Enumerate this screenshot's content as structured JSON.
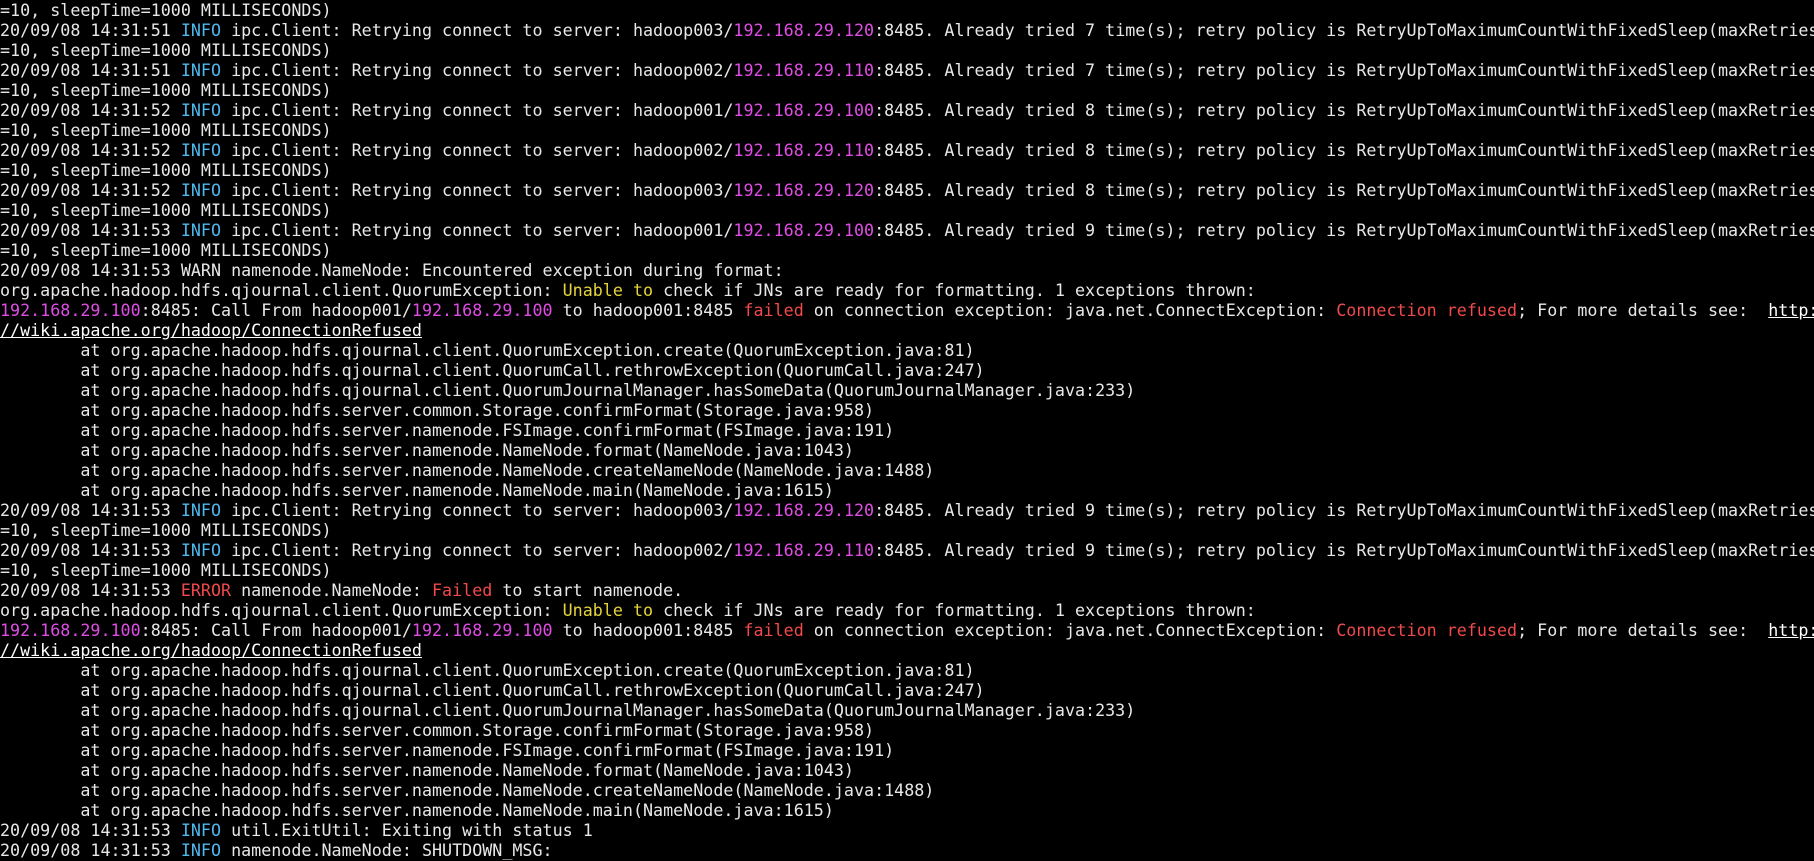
{
  "colors": {
    "background": "#000000",
    "text": "#e8e8e8",
    "info": "#4fb8ec",
    "ip": "#e04ce6",
    "error": "#f04a4a",
    "warning_phrase": "#e6d43a",
    "link": "#ffffff"
  },
  "terminal": {
    "lines": [
      [
        {
          "t": "=10, sleepTime=1000 MILLISECONDS)",
          "s": "plain"
        }
      ],
      [
        {
          "t": "20/09/08 14:31:51 ",
          "s": "plain"
        },
        {
          "t": "INFO",
          "s": "info"
        },
        {
          "t": " ipc.Client: Retrying connect to server: hadoop003/",
          "s": "plain"
        },
        {
          "t": "192.168.29.120",
          "s": "ip"
        },
        {
          "t": ":8485. Already tried 7 time(s); retry policy is RetryUpToMaximumCountWithFixedSleep(maxRetries",
          "s": "plain"
        }
      ],
      [
        {
          "t": "=10, sleepTime=1000 MILLISECONDS)",
          "s": "plain"
        }
      ],
      [
        {
          "t": "20/09/08 14:31:51 ",
          "s": "plain"
        },
        {
          "t": "INFO",
          "s": "info"
        },
        {
          "t": " ipc.Client: Retrying connect to server: hadoop002/",
          "s": "plain"
        },
        {
          "t": "192.168.29.110",
          "s": "ip"
        },
        {
          "t": ":8485. Already tried 7 time(s); retry policy is RetryUpToMaximumCountWithFixedSleep(maxRetries",
          "s": "plain"
        }
      ],
      [
        {
          "t": "=10, sleepTime=1000 MILLISECONDS)",
          "s": "plain"
        }
      ],
      [
        {
          "t": "20/09/08 14:31:52 ",
          "s": "plain"
        },
        {
          "t": "INFO",
          "s": "info"
        },
        {
          "t": " ipc.Client: Retrying connect to server: hadoop001/",
          "s": "plain"
        },
        {
          "t": "192.168.29.100",
          "s": "ip"
        },
        {
          "t": ":8485. Already tried 8 time(s); retry policy is RetryUpToMaximumCountWithFixedSleep(maxRetries",
          "s": "plain"
        }
      ],
      [
        {
          "t": "=10, sleepTime=1000 MILLISECONDS)",
          "s": "plain"
        }
      ],
      [
        {
          "t": "20/09/08 14:31:52 ",
          "s": "plain"
        },
        {
          "t": "INFO",
          "s": "info"
        },
        {
          "t": " ipc.Client: Retrying connect to server: hadoop002/",
          "s": "plain"
        },
        {
          "t": "192.168.29.110",
          "s": "ip"
        },
        {
          "t": ":8485. Already tried 8 time(s); retry policy is RetryUpToMaximumCountWithFixedSleep(maxRetries",
          "s": "plain"
        }
      ],
      [
        {
          "t": "=10, sleepTime=1000 MILLISECONDS)",
          "s": "plain"
        }
      ],
      [
        {
          "t": "20/09/08 14:31:52 ",
          "s": "plain"
        },
        {
          "t": "INFO",
          "s": "info"
        },
        {
          "t": " ipc.Client: Retrying connect to server: hadoop003/",
          "s": "plain"
        },
        {
          "t": "192.168.29.120",
          "s": "ip"
        },
        {
          "t": ":8485. Already tried 8 time(s); retry policy is RetryUpToMaximumCountWithFixedSleep(maxRetries",
          "s": "plain"
        }
      ],
      [
        {
          "t": "=10, sleepTime=1000 MILLISECONDS)",
          "s": "plain"
        }
      ],
      [
        {
          "t": "20/09/08 14:31:53 ",
          "s": "plain"
        },
        {
          "t": "INFO",
          "s": "info"
        },
        {
          "t": " ipc.Client: Retrying connect to server: hadoop001/",
          "s": "plain"
        },
        {
          "t": "192.168.29.100",
          "s": "ip"
        },
        {
          "t": ":8485. Already tried 9 time(s); retry policy is RetryUpToMaximumCountWithFixedSleep(maxRetries",
          "s": "plain"
        }
      ],
      [
        {
          "t": "=10, sleepTime=1000 MILLISECONDS)",
          "s": "plain"
        }
      ],
      [
        {
          "t": "20/09/08 14:31:53 WARN namenode.NameNode: Encountered exception during format:",
          "s": "plain"
        }
      ],
      [
        {
          "t": "org.apache.hadoop.hdfs.qjournal.client.QuorumException: ",
          "s": "plain"
        },
        {
          "t": "Unable to",
          "s": "unable"
        },
        {
          "t": " check if JNs are ready for formatting. 1 exceptions thrown:",
          "s": "plain"
        }
      ],
      [
        {
          "t": "192.168.29.100",
          "s": "ip"
        },
        {
          "t": ":8485: Call From hadoop001/",
          "s": "plain"
        },
        {
          "t": "192.168.29.100",
          "s": "ip"
        },
        {
          "t": " to hadoop001:8485 ",
          "s": "plain"
        },
        {
          "t": "failed",
          "s": "failed"
        },
        {
          "t": " on connection exception: java.net.ConnectException: ",
          "s": "plain"
        },
        {
          "t": "Connection refused",
          "s": "refused"
        },
        {
          "t": "; For more details see:  ",
          "s": "plain"
        },
        {
          "t": "http:",
          "s": "link"
        }
      ],
      [
        {
          "t": "//wiki.apache.org/hadoop/ConnectionRefused",
          "s": "link"
        }
      ],
      [
        {
          "t": "        at org.apache.hadoop.hdfs.qjournal.client.QuorumException.create(QuorumException.java:81)",
          "s": "plain"
        }
      ],
      [
        {
          "t": "        at org.apache.hadoop.hdfs.qjournal.client.QuorumCall.rethrowException(QuorumCall.java:247)",
          "s": "plain"
        }
      ],
      [
        {
          "t": "        at org.apache.hadoop.hdfs.qjournal.client.QuorumJournalManager.hasSomeData(QuorumJournalManager.java:233)",
          "s": "plain"
        }
      ],
      [
        {
          "t": "        at org.apache.hadoop.hdfs.server.common.Storage.confirmFormat(Storage.java:958)",
          "s": "plain"
        }
      ],
      [
        {
          "t": "        at org.apache.hadoop.hdfs.server.namenode.FSImage.confirmFormat(FSImage.java:191)",
          "s": "plain"
        }
      ],
      [
        {
          "t": "        at org.apache.hadoop.hdfs.server.namenode.NameNode.format(NameNode.java:1043)",
          "s": "plain"
        }
      ],
      [
        {
          "t": "        at org.apache.hadoop.hdfs.server.namenode.NameNode.createNameNode(NameNode.java:1488)",
          "s": "plain"
        }
      ],
      [
        {
          "t": "        at org.apache.hadoop.hdfs.server.namenode.NameNode.main(NameNode.java:1615)",
          "s": "plain"
        }
      ],
      [
        {
          "t": "20/09/08 14:31:53 ",
          "s": "plain"
        },
        {
          "t": "INFO",
          "s": "info"
        },
        {
          "t": " ipc.Client: Retrying connect to server: hadoop003/",
          "s": "plain"
        },
        {
          "t": "192.168.29.120",
          "s": "ip"
        },
        {
          "t": ":8485. Already tried 9 time(s); retry policy is RetryUpToMaximumCountWithFixedSleep(maxRetries",
          "s": "plain"
        }
      ],
      [
        {
          "t": "=10, sleepTime=1000 MILLISECONDS)",
          "s": "plain"
        }
      ],
      [
        {
          "t": "20/09/08 14:31:53 ",
          "s": "plain"
        },
        {
          "t": "INFO",
          "s": "info"
        },
        {
          "t": " ipc.Client: Retrying connect to server: hadoop002/",
          "s": "plain"
        },
        {
          "t": "192.168.29.110",
          "s": "ip"
        },
        {
          "t": ":8485. Already tried 9 time(s); retry policy is RetryUpToMaximumCountWithFixedSleep(maxRetries",
          "s": "plain"
        }
      ],
      [
        {
          "t": "=10, sleepTime=1000 MILLISECONDS)",
          "s": "plain"
        }
      ],
      [
        {
          "t": "20/09/08 14:31:53 ",
          "s": "plain"
        },
        {
          "t": "ERROR",
          "s": "error"
        },
        {
          "t": " namenode.NameNode: ",
          "s": "plain"
        },
        {
          "t": "Failed",
          "s": "failed"
        },
        {
          "t": " to start namenode.",
          "s": "plain"
        }
      ],
      [
        {
          "t": "org.apache.hadoop.hdfs.qjournal.client.QuorumException: ",
          "s": "plain"
        },
        {
          "t": "Unable to",
          "s": "unable"
        },
        {
          "t": " check if JNs are ready for formatting. 1 exceptions thrown:",
          "s": "plain"
        }
      ],
      [
        {
          "t": "192.168.29.100",
          "s": "ip"
        },
        {
          "t": ":8485: Call From hadoop001/",
          "s": "plain"
        },
        {
          "t": "192.168.29.100",
          "s": "ip"
        },
        {
          "t": " to hadoop001:8485 ",
          "s": "plain"
        },
        {
          "t": "failed",
          "s": "failed"
        },
        {
          "t": " on connection exception: java.net.ConnectException: ",
          "s": "plain"
        },
        {
          "t": "Connection refused",
          "s": "refused"
        },
        {
          "t": "; For more details see:  ",
          "s": "plain"
        },
        {
          "t": "http:",
          "s": "link"
        }
      ],
      [
        {
          "t": "//wiki.apache.org/hadoop/ConnectionRefused",
          "s": "link"
        }
      ],
      [
        {
          "t": "        at org.apache.hadoop.hdfs.qjournal.client.QuorumException.create(QuorumException.java:81)",
          "s": "plain"
        }
      ],
      [
        {
          "t": "        at org.apache.hadoop.hdfs.qjournal.client.QuorumCall.rethrowException(QuorumCall.java:247)",
          "s": "plain"
        }
      ],
      [
        {
          "t": "        at org.apache.hadoop.hdfs.qjournal.client.QuorumJournalManager.hasSomeData(QuorumJournalManager.java:233)",
          "s": "plain"
        }
      ],
      [
        {
          "t": "        at org.apache.hadoop.hdfs.server.common.Storage.confirmFormat(Storage.java:958)",
          "s": "plain"
        }
      ],
      [
        {
          "t": "        at org.apache.hadoop.hdfs.server.namenode.FSImage.confirmFormat(FSImage.java:191)",
          "s": "plain"
        }
      ],
      [
        {
          "t": "        at org.apache.hadoop.hdfs.server.namenode.NameNode.format(NameNode.java:1043)",
          "s": "plain"
        }
      ],
      [
        {
          "t": "        at org.apache.hadoop.hdfs.server.namenode.NameNode.createNameNode(NameNode.java:1488)",
          "s": "plain"
        }
      ],
      [
        {
          "t": "        at org.apache.hadoop.hdfs.server.namenode.NameNode.main(NameNode.java:1615)",
          "s": "plain"
        }
      ],
      [
        {
          "t": "20/09/08 14:31:53 ",
          "s": "plain"
        },
        {
          "t": "INFO",
          "s": "info"
        },
        {
          "t": " util.ExitUtil: Exiting with status 1",
          "s": "plain"
        }
      ],
      [
        {
          "t": "20/09/08 14:31:53 ",
          "s": "plain"
        },
        {
          "t": "INFO",
          "s": "info"
        },
        {
          "t": " namenode.NameNode: SHUTDOWN_MSG:",
          "s": "plain"
        }
      ]
    ]
  }
}
